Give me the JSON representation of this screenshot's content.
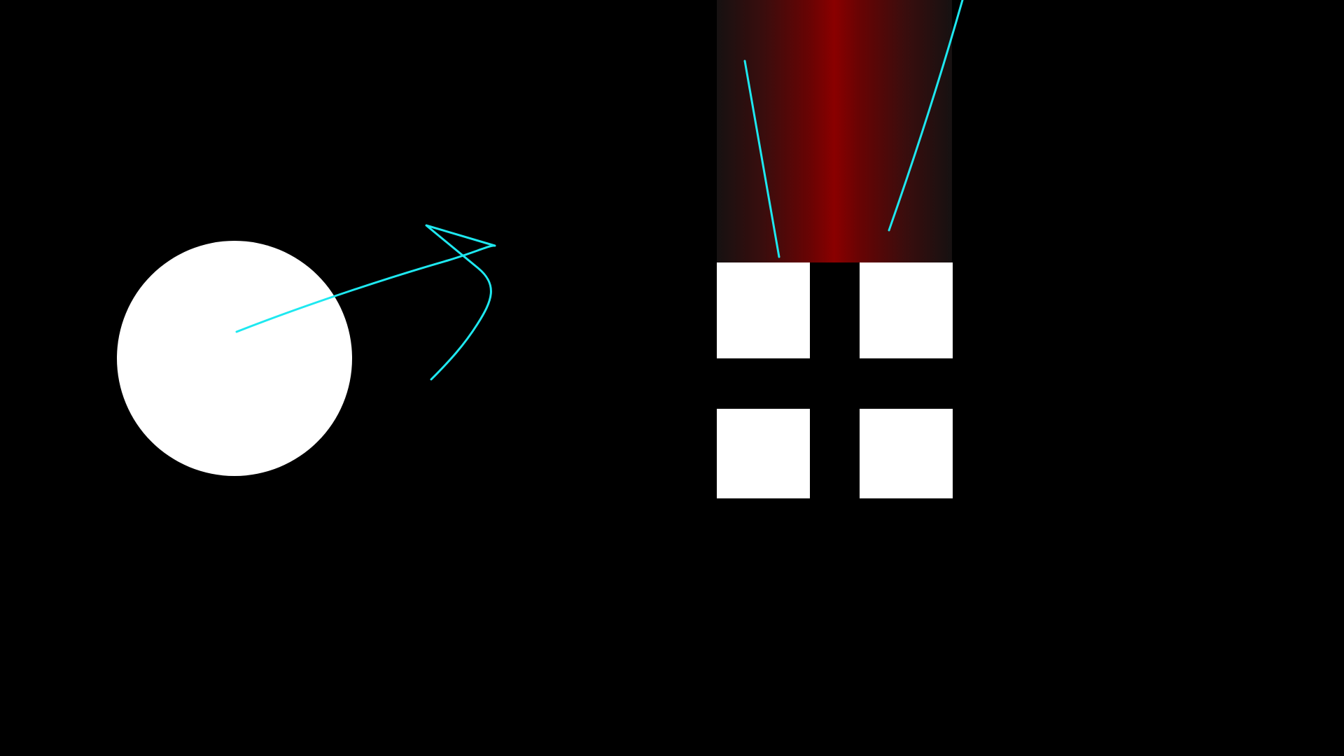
{
  "scene": {
    "background_color": "#000000",
    "shape_color": "#ffffff",
    "stroke_color": "#1ee8f0",
    "beam_center_color": "#8a0000",
    "beam_edge_color": "#161111",
    "elements": [
      "white-circle",
      "curved-arrow-stroke",
      "red-light-beam",
      "four-white-squares",
      "two-cyan-line-strokes"
    ]
  }
}
